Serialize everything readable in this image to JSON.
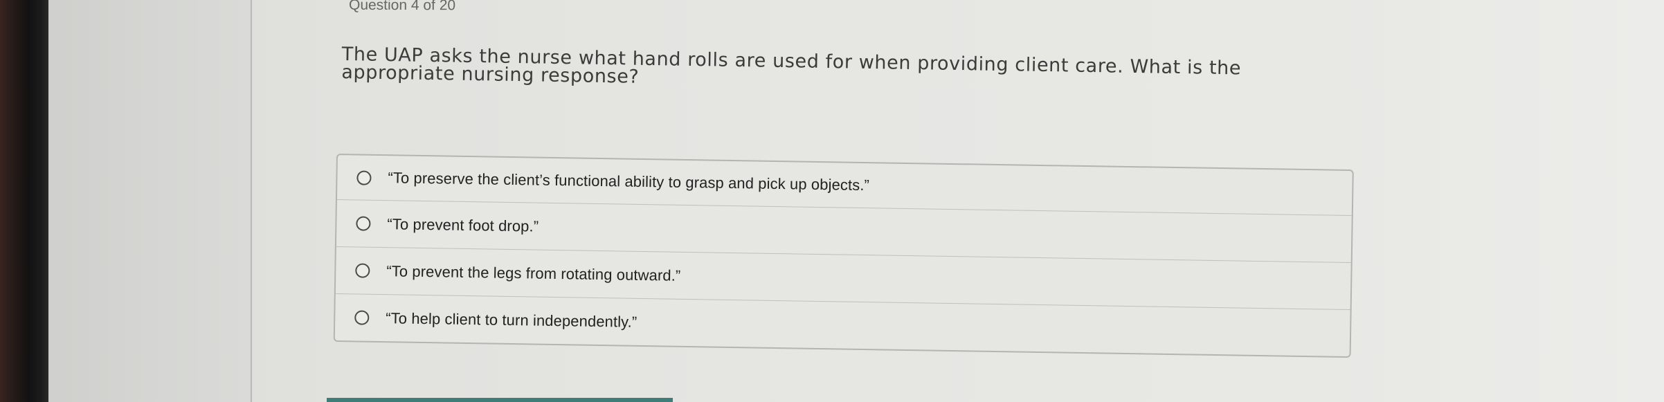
{
  "quiz": {
    "counter": "Question 4 of 20",
    "question": "The UAP asks the nurse what hand rolls are used for when providing client care. What is the appropriate nursing response?",
    "options": [
      {
        "label": "“To preserve the client’s functional ability to grasp and pick up objects.”",
        "selected": false
      },
      {
        "label": "“To prevent foot drop.”",
        "selected": false
      },
      {
        "label": "“To prevent the legs from rotating outward.”",
        "selected": false
      },
      {
        "label": "“To help client to turn independently.”",
        "selected": false
      }
    ]
  },
  "colors": {
    "background": "#e6e6e3",
    "text": "#3b3b3b",
    "border": "#b4b4b1",
    "accent": "#3f7e78"
  }
}
